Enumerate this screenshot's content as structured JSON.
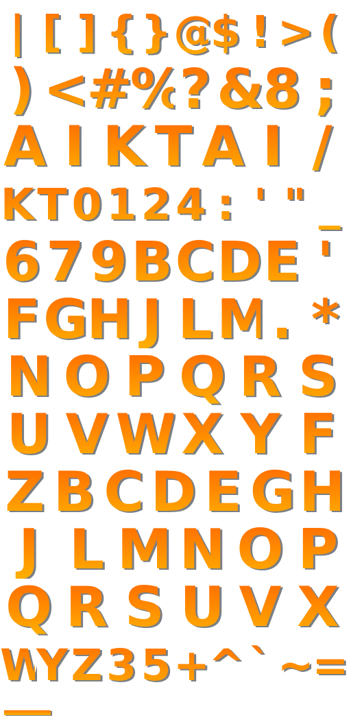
{
  "rows": [
    "|[]{}@$!>(",
    ")<#%?&8;",
    "AIKTAI/",
    "KT0124:'\"_",
    "679BCDE'",
    "FGHJLM.*",
    "NOPQRS",
    "UVWXYF",
    "ZBCDEGH",
    "JLMNOP",
    "QRSUVX",
    "WYZ35+^`~="
  ],
  "colors": {
    "fill_top": "#ff6a00",
    "fill_bottom": "#ffb000",
    "shadow": "#7a7f85",
    "background": "#ffffff"
  }
}
